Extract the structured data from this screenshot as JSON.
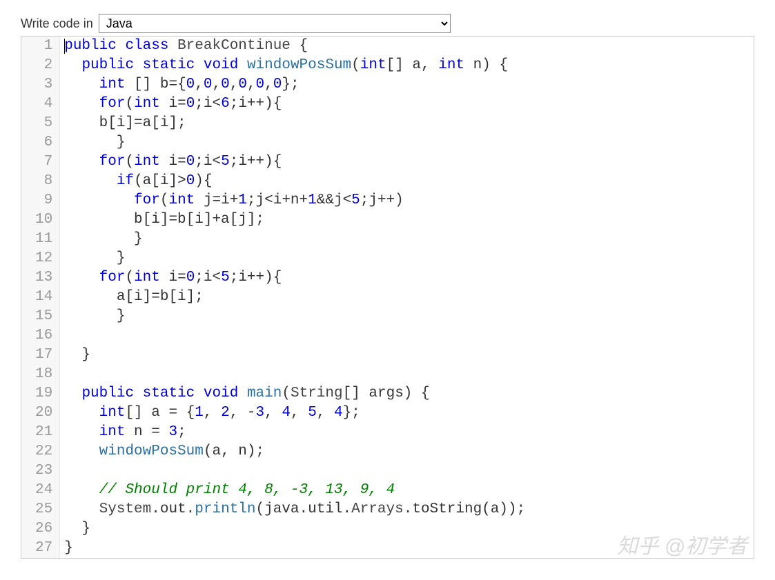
{
  "header": {
    "label": "Write code in",
    "language": "Java"
  },
  "watermark": "知乎 @初学者",
  "code": {
    "line_count": 27,
    "lines": [
      {
        "n": 1,
        "tokens": [
          [
            "kw",
            "public"
          ],
          [
            "",
            ""
          ],
          [
            "kw",
            "class"
          ],
          [
            "",
            " "
          ],
          [
            "cls",
            "BreakContinue"
          ],
          [
            "",
            " {"
          ]
        ]
      },
      {
        "n": 2,
        "indent": 1,
        "tokens": [
          [
            "kw",
            "public"
          ],
          [
            "",
            " "
          ],
          [
            "kw",
            "static"
          ],
          [
            "",
            " "
          ],
          [
            "ty",
            "void"
          ],
          [
            "",
            " "
          ],
          [
            "fn",
            "windowPosSum"
          ],
          [
            "",
            "("
          ],
          [
            "ty",
            "int"
          ],
          [
            "",
            "[] a, "
          ],
          [
            "ty",
            "int"
          ],
          [
            "",
            " n) {"
          ]
        ]
      },
      {
        "n": 3,
        "indent": 2,
        "tokens": [
          [
            "ty",
            "int"
          ],
          [
            "",
            " [] b={"
          ],
          [
            "num",
            "0"
          ],
          [
            "",
            ","
          ],
          [
            "num",
            "0"
          ],
          [
            "",
            ","
          ],
          [
            "num",
            "0"
          ],
          [
            "",
            ","
          ],
          [
            "num",
            "0"
          ],
          [
            "",
            ","
          ],
          [
            "num",
            "0"
          ],
          [
            "",
            ","
          ],
          [
            "num",
            "0"
          ],
          [
            "",
            "};"
          ]
        ]
      },
      {
        "n": 4,
        "indent": 2,
        "tokens": [
          [
            "kw",
            "for"
          ],
          [
            "",
            "("
          ],
          [
            "ty",
            "int"
          ],
          [
            "",
            " i="
          ],
          [
            "num",
            "0"
          ],
          [
            "",
            ";i<"
          ],
          [
            "num",
            "6"
          ],
          [
            "",
            ";i++){"
          ]
        ]
      },
      {
        "n": 5,
        "indent": 2,
        "tokens": [
          [
            "",
            "b[i]=a[i];"
          ]
        ]
      },
      {
        "n": 6,
        "indent": 3,
        "tokens": [
          [
            "",
            "}"
          ]
        ]
      },
      {
        "n": 7,
        "indent": 2,
        "tokens": [
          [
            "kw",
            "for"
          ],
          [
            "",
            "("
          ],
          [
            "ty",
            "int"
          ],
          [
            "",
            " i="
          ],
          [
            "num",
            "0"
          ],
          [
            "",
            ";i<"
          ],
          [
            "num",
            "5"
          ],
          [
            "",
            ";i++){"
          ]
        ]
      },
      {
        "n": 8,
        "indent": 3,
        "tokens": [
          [
            "kw",
            "if"
          ],
          [
            "",
            "(a[i]>"
          ],
          [
            "num",
            "0"
          ],
          [
            "",
            "){"
          ]
        ]
      },
      {
        "n": 9,
        "indent": 4,
        "tokens": [
          [
            "kw",
            "for"
          ],
          [
            "",
            "("
          ],
          [
            "ty",
            "int"
          ],
          [
            "",
            " j=i+"
          ],
          [
            "num",
            "1"
          ],
          [
            "",
            ";j<i+n+"
          ],
          [
            "num",
            "1"
          ],
          [
            "",
            "&&j<"
          ],
          [
            "num",
            "5"
          ],
          [
            "",
            ";j++)"
          ]
        ]
      },
      {
        "n": 10,
        "indent": 4,
        "tokens": [
          [
            "",
            "b[i]=b[i]+a[j];"
          ]
        ]
      },
      {
        "n": 11,
        "indent": 4,
        "tokens": [
          [
            "",
            "}"
          ]
        ]
      },
      {
        "n": 12,
        "indent": 3,
        "tokens": [
          [
            "",
            "}"
          ]
        ]
      },
      {
        "n": 13,
        "indent": 2,
        "tokens": [
          [
            "kw",
            "for"
          ],
          [
            "",
            "("
          ],
          [
            "ty",
            "int"
          ],
          [
            "",
            " i="
          ],
          [
            "num",
            "0"
          ],
          [
            "",
            ";i<"
          ],
          [
            "num",
            "5"
          ],
          [
            "",
            ";i++){"
          ]
        ]
      },
      {
        "n": 14,
        "indent": 3,
        "tokens": [
          [
            "",
            "a[i]=b[i];"
          ]
        ]
      },
      {
        "n": 15,
        "indent": 3,
        "tokens": [
          [
            "",
            "}"
          ]
        ]
      },
      {
        "n": 16,
        "indent": 0,
        "tokens": []
      },
      {
        "n": 17,
        "indent": 1,
        "tokens": [
          [
            "",
            "}"
          ]
        ]
      },
      {
        "n": 18,
        "indent": 0,
        "tokens": []
      },
      {
        "n": 19,
        "indent": 1,
        "tokens": [
          [
            "kw",
            "public"
          ],
          [
            "",
            " "
          ],
          [
            "kw",
            "static"
          ],
          [
            "",
            " "
          ],
          [
            "ty",
            "void"
          ],
          [
            "",
            " "
          ],
          [
            "fn",
            "main"
          ],
          [
            "",
            "("
          ],
          [
            "cls",
            "String"
          ],
          [
            "",
            "[] args) {"
          ]
        ]
      },
      {
        "n": 20,
        "indent": 2,
        "tokens": [
          [
            "ty",
            "int"
          ],
          [
            "",
            "[] a = {"
          ],
          [
            "num",
            "1"
          ],
          [
            "",
            ", "
          ],
          [
            "num",
            "2"
          ],
          [
            "",
            ", -"
          ],
          [
            "num",
            "3"
          ],
          [
            "",
            ", "
          ],
          [
            "num",
            "4"
          ],
          [
            "",
            ", "
          ],
          [
            "num",
            "5"
          ],
          [
            "",
            ", "
          ],
          [
            "num",
            "4"
          ],
          [
            "",
            "};"
          ]
        ]
      },
      {
        "n": 21,
        "indent": 2,
        "tokens": [
          [
            "ty",
            "int"
          ],
          [
            "",
            " n = "
          ],
          [
            "num",
            "3"
          ],
          [
            "",
            ";"
          ]
        ]
      },
      {
        "n": 22,
        "indent": 2,
        "tokens": [
          [
            "fn",
            "windowPosSum"
          ],
          [
            "",
            "(a, n);"
          ]
        ]
      },
      {
        "n": 23,
        "indent": 0,
        "tokens": []
      },
      {
        "n": 24,
        "indent": 2,
        "tokens": [
          [
            "cm",
            "// Should print 4, 8, -3, 13, 9, 4"
          ]
        ]
      },
      {
        "n": 25,
        "indent": 2,
        "tokens": [
          [
            "cls",
            "System"
          ],
          [
            "",
            ".out."
          ],
          [
            "fn",
            "println"
          ],
          [
            "",
            "(java.util."
          ],
          [
            "cls",
            "Arrays"
          ],
          [
            "",
            ".toString(a));"
          ]
        ]
      },
      {
        "n": 26,
        "indent": 1,
        "tokens": [
          [
            "",
            "}"
          ]
        ]
      },
      {
        "n": 27,
        "indent": 0,
        "tokens": [
          [
            "",
            "}"
          ]
        ]
      }
    ]
  }
}
